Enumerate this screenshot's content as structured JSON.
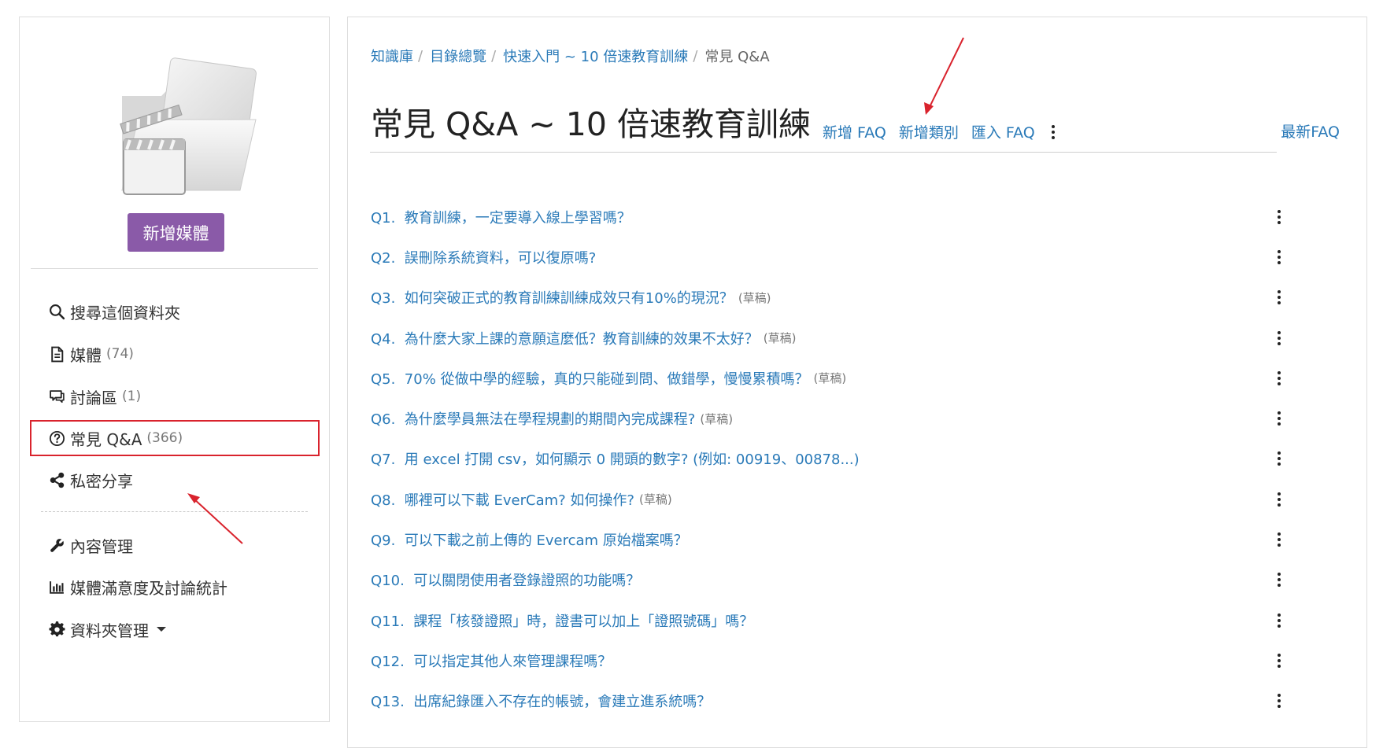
{
  "sidebar": {
    "add_media_label": "新增媒體",
    "items": [
      {
        "icon": "search-icon",
        "label": "搜尋這個資料夾",
        "count": ""
      },
      {
        "icon": "document-icon",
        "label": "媒體",
        "count": "(74)"
      },
      {
        "icon": "comments-icon",
        "label": "討論區",
        "count": "(1)"
      },
      {
        "icon": "question-circle-icon",
        "label": "常見 Q&A",
        "count": "(366)"
      },
      {
        "icon": "share-icon",
        "label": "私密分享",
        "count": ""
      },
      {
        "icon": "wrench-icon",
        "label": "內容管理",
        "count": ""
      },
      {
        "icon": "bar-chart-icon",
        "label": "媒體滿意度及討論統計",
        "count": ""
      },
      {
        "icon": "gear-icon",
        "label": "資料夾管理",
        "count": ""
      }
    ]
  },
  "breadcrumb": {
    "items": [
      "知識庫",
      "目錄總覽",
      "快速入門 ~ 10 倍速教育訓練"
    ],
    "current": "常見 Q&A"
  },
  "header": {
    "title": "常見 Q&A ~ 10 倍速教育訓練",
    "add_faq": "新增 FAQ",
    "add_category": "新增類別",
    "import_faq": "匯入 FAQ",
    "latest_faq": "最新FAQ"
  },
  "faqs": [
    {
      "q": "Q1.",
      "text": "教育訓練，一定要導入線上學習嗎？",
      "draft": ""
    },
    {
      "q": "Q2.",
      "text": "誤刪除系統資料，可以復原嗎?",
      "draft": ""
    },
    {
      "q": "Q3.",
      "text": "如何突破正式的教育訓練訓練成效只有10%的現況？",
      "draft": "(草稿)"
    },
    {
      "q": "Q4.",
      "text": "為什麼大家上課的意願這麼低？教育訓練的效果不太好？",
      "draft": "(草稿)"
    },
    {
      "q": "Q5.",
      "text": "70% 從做中學的經驗，真的只能碰到問、做錯學，慢慢累積嗎？",
      "draft": "(草稿)"
    },
    {
      "q": "Q6.",
      "text": "為什麼學員無法在學程規劃的期間內完成課程?",
      "draft": "(草稿)"
    },
    {
      "q": "Q7.",
      "text": "用 excel 打開 csv，如何顯示 0 開頭的數字? (例如: 00919、00878...)",
      "draft": ""
    },
    {
      "q": "Q8.",
      "text": "哪裡可以下載 EverCam? 如何操作?",
      "draft": "(草稿)"
    },
    {
      "q": "Q9.",
      "text": "可以下載之前上傳的 Evercam 原始檔案嗎？",
      "draft": ""
    },
    {
      "q": "Q10.",
      "text": "可以關閉使用者登錄證照的功能嗎？",
      "draft": ""
    },
    {
      "q": "Q11.",
      "text": "課程「核發證照」時，證書可以加上「證照號碼」嗎？",
      "draft": ""
    },
    {
      "q": "Q12.",
      "text": "可以指定其他人來管理課程嗎？",
      "draft": ""
    },
    {
      "q": "Q13.",
      "text": "出席紀錄匯入不存在的帳號，會建立進系統嗎？",
      "draft": ""
    }
  ],
  "colors": {
    "link": "#2a7ab8",
    "accent_button": "#8a5aa8",
    "annotation_red": "#d9232d"
  }
}
